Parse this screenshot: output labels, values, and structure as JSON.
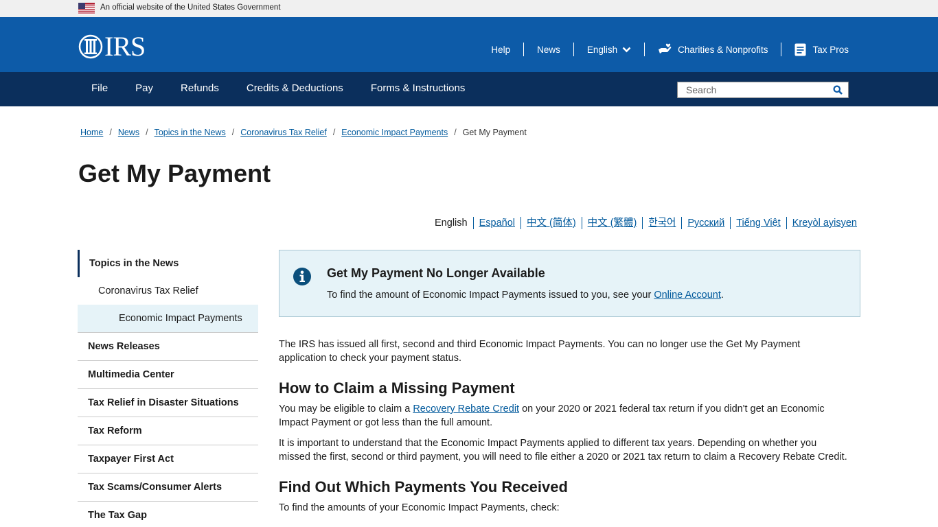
{
  "gov_banner": {
    "text": "An official website of the United States Government"
  },
  "header": {
    "logo_text": "IRS",
    "util_nav": {
      "help": "Help",
      "news": "News",
      "language": "English",
      "charities": "Charities & Nonprofits",
      "taxpros": "Tax Pros"
    }
  },
  "main_nav": {
    "items": [
      "File",
      "Pay",
      "Refunds",
      "Credits & Deductions",
      "Forms & Instructions"
    ],
    "search_placeholder": "Search"
  },
  "breadcrumb": {
    "items": [
      "Home",
      "News",
      "Topics in the News",
      "Coronavirus Tax Relief",
      "Economic Impact Payments"
    ],
    "current": "Get My Payment"
  },
  "page_title": "Get My Payment",
  "languages": {
    "active": "English",
    "links": [
      "Español",
      "中文 (简体)",
      "中文 (繁體)",
      "한국어",
      "Русский",
      "Tiếng Việt",
      "Kreyòl ayisyen"
    ]
  },
  "sidebar": {
    "top": "Topics in the News",
    "sub": "Coronavirus Tax Relief",
    "subsub": "Economic Impact Payments",
    "items": [
      "News Releases",
      "Multimedia Center",
      "Tax Relief in Disaster Situations",
      "Tax Reform",
      "Taxpayer First Act",
      "Tax Scams/Consumer Alerts",
      "The Tax Gap"
    ]
  },
  "alert": {
    "title": "Get My Payment No Longer Available",
    "body_prefix": "To find the amount of Economic Impact Payments issued to you, see your ",
    "link": "Online Account",
    "body_suffix": "."
  },
  "content": {
    "intro": "The IRS has issued all first, second and third Economic Impact Payments. You can no longer use the Get My Payment application to check your payment status.",
    "h2_claim": "How to Claim a Missing Payment",
    "p1_prefix": "You may be eligible to claim a ",
    "p1_link": "Recovery Rebate Credit",
    "p1_suffix": " on your 2020 or 2021 federal tax return if you didn't get an Economic Impact Payment or got less than the full amount.",
    "p2": "It is important to understand that the Economic Impact Payments applied to different tax years. Depending on whether you missed the first, second or third payment, you will need to file either a 2020 or 2021 tax return to claim a Recovery Rebate Credit.",
    "h2_find": "Find Out Which Payments You Received",
    "p3": "To find the amounts of your Economic Impact Payments, check:"
  },
  "colors": {
    "header_blue": "#0d5ba8",
    "nav_navy": "#0b2f5c",
    "link_blue": "#00599c",
    "alert_bg": "#e6f3f8"
  }
}
